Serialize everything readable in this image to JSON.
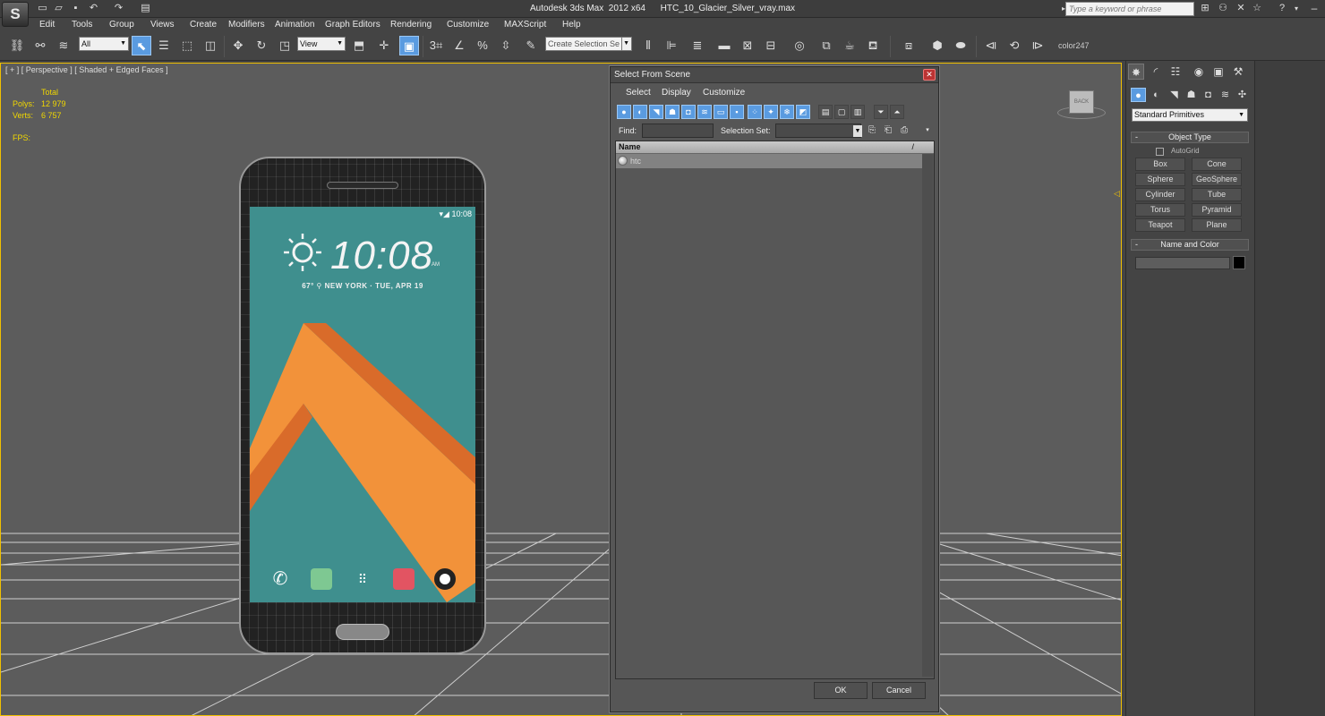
{
  "titlebar": {
    "app_title": "Autodesk 3ds Max  2012 x64      HTC_10_Glacier_Silver_vray.max",
    "search_placeholder": "Type a keyword or phrase",
    "logo": "S"
  },
  "menu": [
    "Edit",
    "Tools",
    "Group",
    "Views",
    "Create",
    "Modifiers",
    "Animation",
    "Graph Editors",
    "Rendering",
    "Customize",
    "MAXScript",
    "Help"
  ],
  "toolbar": {
    "selection_filter": "All",
    "ref_coord": "View",
    "named_selection_placeholder": "Create Selection Se",
    "snap_label": "3",
    "angle_snap": "%",
    "color_label": "color247"
  },
  "viewport": {
    "label": "[ + ] [ Perspective ] [ Shaded + Edged Faces ]",
    "stats": {
      "total_label": "Total",
      "polys_label": "Polys:",
      "polys_value": "12 979",
      "verts_label": "Verts:",
      "verts_value": "6 757",
      "fps_label": "FPS:"
    },
    "phone_screen": {
      "status_time": "10:08",
      "clock": "10:08",
      "ampm": "AM",
      "weather": "67° ⚲ NEW YORK  ·  TUE, APR 19"
    },
    "viewcube_label": "BACK"
  },
  "dialog": {
    "title": "Select From Scene",
    "close_glyph": "✕",
    "menus": [
      "Select",
      "Display",
      "Customize"
    ],
    "find_label": "Find:",
    "selection_set_label": "Selection Set:",
    "column_name": "Name",
    "sort_glyph": "/",
    "rows": [
      "htc"
    ],
    "ok_label": "OK",
    "cancel_label": "Cancel"
  },
  "command_panel": {
    "primitive_type": "Standard Primitives",
    "object_type_header": "Object Type",
    "autogrid_label": "AutoGrid",
    "buttons": [
      "Box",
      "Cone",
      "Sphere",
      "GeoSphere",
      "Cylinder",
      "Tube",
      "Torus",
      "Pyramid",
      "Teapot",
      "Plane"
    ],
    "name_color_header": "Name and Color",
    "collapse_glyph": "-"
  }
}
